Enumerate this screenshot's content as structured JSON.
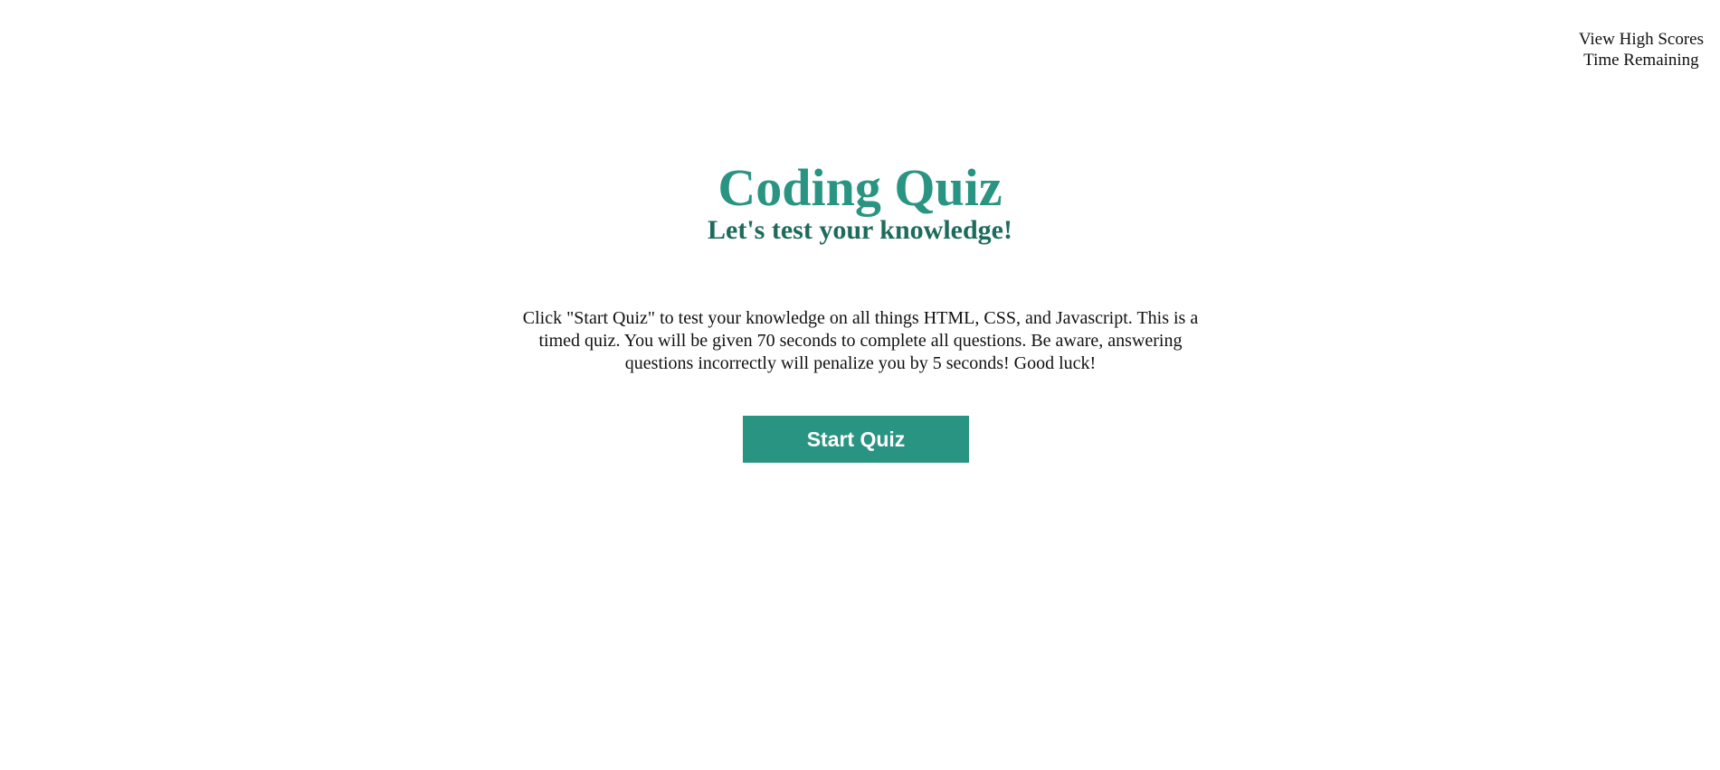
{
  "header": {
    "high_scores_link": "View High Scores",
    "timer_label": "Time Remaining"
  },
  "quiz": {
    "title": "Coding Quiz",
    "subtitle": "Let's test your knowledge!",
    "intro": "Click \"Start Quiz\" to test your knowledge on all things HTML, CSS, and Javascript. This is a timed quiz. You will be given 70 seconds to complete all questions. Be aware, answering questions incorrectly will penalize you by 5 seconds! Good luck!",
    "start_button_label": "Start Quiz"
  },
  "colors": {
    "title": "#2a9482",
    "subtitle": "#1d6b5c",
    "button_bg": "#2a9482",
    "text": "#111111",
    "background": "#ffffff"
  }
}
